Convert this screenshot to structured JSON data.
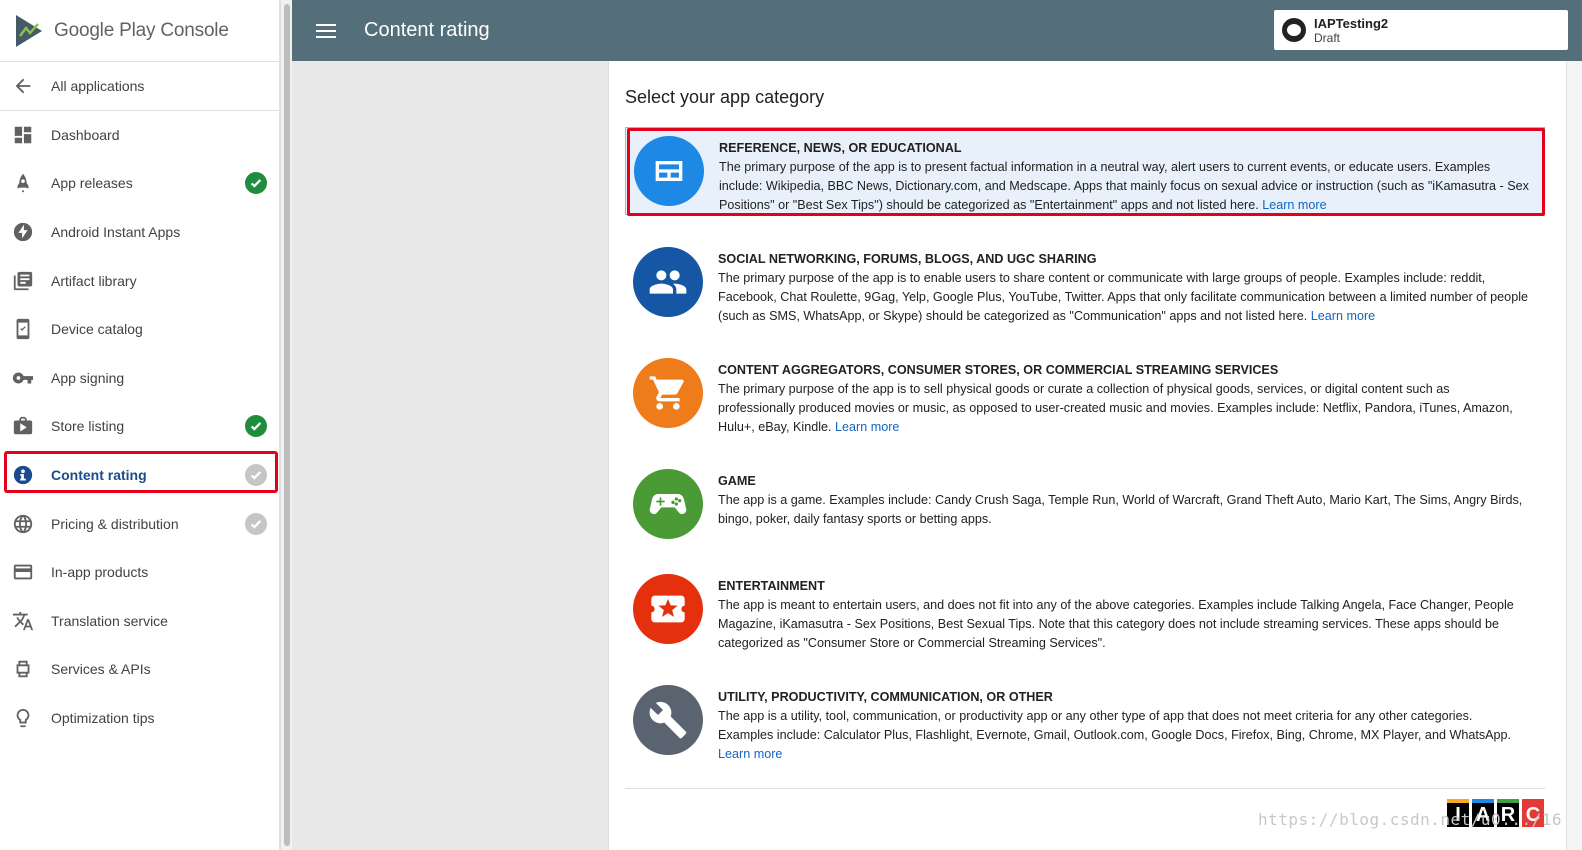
{
  "brand": {
    "name": "Google Play Console"
  },
  "header": {
    "title": "Content rating"
  },
  "app": {
    "name": "IAPTesting2",
    "status": "Draft"
  },
  "sidebar": {
    "all_apps": "All applications",
    "items": [
      {
        "label": "Dashboard",
        "icon": "dashboard-icon",
        "check": "none"
      },
      {
        "label": "App releases",
        "icon": "rocket-icon",
        "check": "done"
      },
      {
        "label": "Android Instant Apps",
        "icon": "bolt-icon",
        "check": "none"
      },
      {
        "label": "Artifact library",
        "icon": "library-icon",
        "check": "none"
      },
      {
        "label": "Device catalog",
        "icon": "device-icon",
        "check": "none"
      },
      {
        "label": "App signing",
        "icon": "key-icon",
        "check": "none"
      },
      {
        "label": "Store listing",
        "icon": "store-icon",
        "check": "done"
      },
      {
        "label": "Content rating",
        "icon": "rating-icon",
        "check": "todo",
        "active": true
      },
      {
        "label": "Pricing & distribution",
        "icon": "globe-icon",
        "check": "todo"
      },
      {
        "label": "In-app products",
        "icon": "card-icon",
        "check": "none"
      },
      {
        "label": "Translation service",
        "icon": "translate-icon",
        "check": "none"
      },
      {
        "label": "Services & APIs",
        "icon": "api-icon",
        "check": "none"
      },
      {
        "label": "Optimization tips",
        "icon": "bulb-icon",
        "check": "none"
      }
    ]
  },
  "main": {
    "title": "Select your app category",
    "categories": [
      {
        "title": "REFERENCE, NEWS, OR EDUCATIONAL",
        "desc": "The primary purpose of the app is to present factual information in a neutral way, alert users to current events, or educate users. Examples include: Wikipedia, BBC News, Dictionary.com, and Medscape. Apps that mainly focus on sexual advice or instruction (such as \"iKamasutra - Sex Positions\" or \"Best Sex Tips\") should be categorized as \"Entertainment\" apps and not listed here. ",
        "learn": "Learn more",
        "icon": "newspaper-icon",
        "color": "#1e88e5",
        "selected": true
      },
      {
        "title": "SOCIAL NETWORKING, FORUMS, BLOGS, AND UGC SHARING",
        "desc": "The primary purpose of the app is to enable users to share content or communicate with large groups of people. Examples include: reddit, Facebook, Chat Roulette, 9Gag, Yelp, Google Plus, YouTube, Twitter. Apps that only facilitate communication between a limited number of people (such as SMS, WhatsApp, or Skype) should be categorized as \"Communication\" apps and not listed here. ",
        "learn": "Learn more",
        "icon": "people-icon",
        "color": "#1557a5"
      },
      {
        "title": "CONTENT AGGREGATORS, CONSUMER STORES, OR COMMERCIAL STREAMING SERVICES",
        "desc": "The primary purpose of the app is to sell physical goods or curate a collection of physical goods, services, or digital content such as professionally produced movies or music, as opposed to user-created music and movies. Examples include: Netflix, Pandora, iTunes, Amazon, Hulu+, eBay, Kindle. ",
        "learn": "Learn more",
        "icon": "cart-icon",
        "color": "#ef7c1a"
      },
      {
        "title": "GAME",
        "desc": "The app is a game. Examples include: Candy Crush Saga, Temple Run, World of Warcraft, Grand Theft Auto, Mario Kart, The Sims, Angry Birds, bingo, poker, daily fantasy sports or betting apps.",
        "learn": "",
        "icon": "gamepad-icon",
        "color": "#4a9a35"
      },
      {
        "title": "ENTERTAINMENT",
        "desc": "The app is meant to entertain users, and does not fit into any of the above categories. Examples include Talking Angela, Face Changer, People Magazine, iKamasutra - Sex Positions, Best Sexual Tips. Note that this category does not include streaming services. These apps should be categorized as \"Consumer Store or Commercial Streaming Services\".",
        "learn": "",
        "icon": "ticket-icon",
        "color": "#e5300e"
      },
      {
        "title": "UTILITY, PRODUCTIVITY, COMMUNICATION, OR OTHER",
        "desc": "The app is a utility, tool, communication, or productivity app or any other type of app that does not meet criteria for any other categories. Examples include: Calculator Plus, Flashlight, Evernote, Gmail, Outlook.com, Google Docs, Firefox, Bing, Chrome, MX Player, and WhatsApp. ",
        "learn": "Learn more",
        "icon": "wrench-icon",
        "color": "#5a6470"
      }
    ]
  },
  "iarc": {
    "letters": [
      "I",
      "A",
      "R",
      "C"
    ]
  },
  "watermark": "https://blog.csdn.net/u0.../16"
}
